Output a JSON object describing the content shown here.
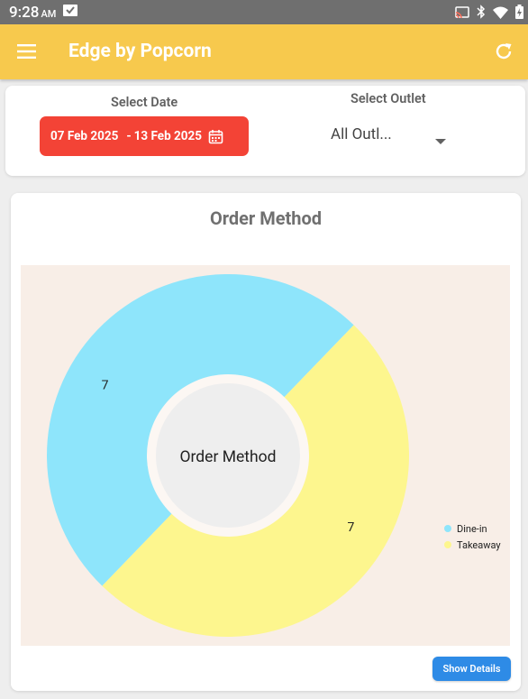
{
  "status_bar": {
    "time": "9:28",
    "ampm": "AM",
    "icons": [
      "screen-mirror-check-icon",
      "cast-icon",
      "bluetooth-icon",
      "wifi-icon",
      "battery-charging-icon"
    ]
  },
  "app_bar": {
    "title": "Edge by Popcorn",
    "menu_icon": "hamburger-menu-icon",
    "refresh_icon": "refresh-icon",
    "background": "#f7c94d"
  },
  "filters": {
    "select_date_label": "Select Date",
    "date_from": "07 Feb 2025",
    "date_separator": "-",
    "date_to": "13 Feb 2025",
    "calendar_icon": "calendar-icon",
    "date_button_color": "#f34336",
    "select_outlet_label": "Select Outlet",
    "outlet_value": "All Outl...",
    "outlet_caret_icon": "dropdown-caret-icon"
  },
  "chart_card": {
    "title": "Order Method",
    "center_label": "Order Method",
    "show_details_label": "Show Details",
    "show_details_color": "#2e8be6"
  },
  "chart_data": {
    "type": "pie",
    "variant": "donut",
    "title": "Order Method",
    "categories": [
      "Dine-in",
      "Takeaway"
    ],
    "values": [
      7,
      7
    ],
    "colors": [
      "#8ee5fb",
      "#fdf68e"
    ],
    "data_labels": [
      "7",
      "7"
    ],
    "legend": {
      "placement": "right",
      "entries": [
        "Dine-in",
        "Takeaway"
      ]
    },
    "background": "#f8eee7"
  }
}
